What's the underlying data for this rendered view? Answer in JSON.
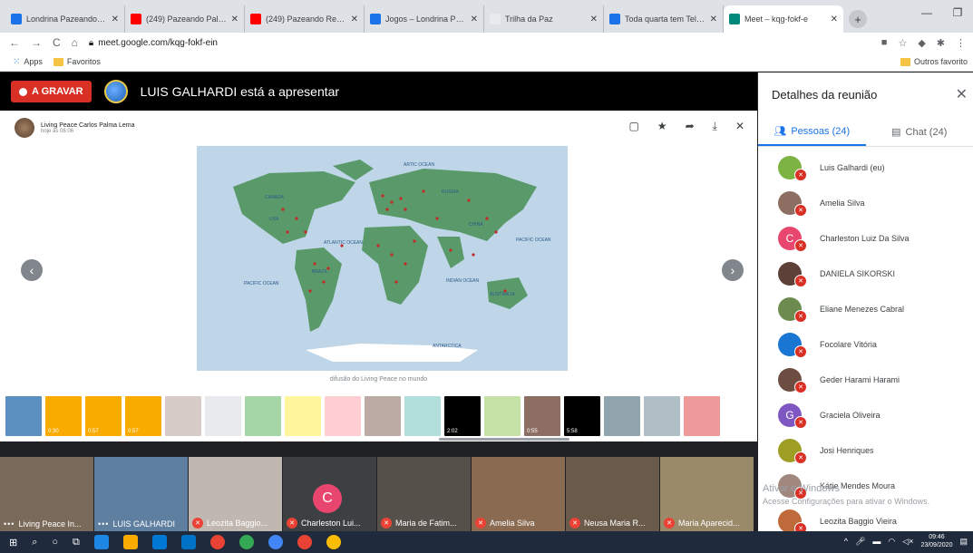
{
  "browser": {
    "tabs": [
      {
        "title": "Londrina Pazeando – E",
        "fav": "#1a73e8",
        "active": false
      },
      {
        "title": "(249) Pazeando Palestr",
        "fav": "#ff0000",
        "active": false
      },
      {
        "title": "(249) Pazeando Report",
        "fav": "#ff0000",
        "active": false
      },
      {
        "title": "Jogos – Londrina Pazea",
        "fav": "#1a73e8",
        "active": false
      },
      {
        "title": "Trilha da Paz",
        "fav": "#e8eaed",
        "active": false
      },
      {
        "title": "Toda quarta tem Telecc",
        "fav": "#1a73e8",
        "active": false
      },
      {
        "title": "Meet – kqg-fokf-e",
        "fav": "#00897b",
        "active": true
      }
    ],
    "url": "meet.google.com/kqg-fokf-ein",
    "bookmarks": {
      "apps": "Apps",
      "favoritos": "Favoritos",
      "outros": "Outros favorito"
    }
  },
  "meeting": {
    "recording": "A GRAVAR",
    "presenter_text": "LUIS GALHARDI está a apresentar"
  },
  "slide": {
    "author": "Living Peace Carlos Palma Lema",
    "time": "hoje às 06:06",
    "caption": "difusão do Living Peace no mundo",
    "map_labels": {
      "artic": "ARTIC OCEAN",
      "russia": "RUSSIA",
      "canada": "CANADA",
      "usa": "USA",
      "china": "CHINA",
      "atlantic": "ATLANTIC OCEAN",
      "pacific_right": "PACIFIC OCEAN",
      "pacific_left": "PACIFIC OCEAN",
      "brazil": "BRAZIL",
      "indian": "INDIAN OCEAN",
      "australia": "AUSTRALIA",
      "antarctica": "ANTARCTICA"
    },
    "thumbnails": [
      {
        "color": "#5b8fbf",
        "cap": ""
      },
      {
        "color": "#f9ab00",
        "cap": "0:30"
      },
      {
        "color": "#f9ab00",
        "cap": "0:57"
      },
      {
        "color": "#f9ab00",
        "cap": "0:57"
      },
      {
        "color": "#d7ccc8",
        "cap": ""
      },
      {
        "color": "#e8eaed",
        "cap": ""
      },
      {
        "color": "#a5d6a7",
        "cap": ""
      },
      {
        "color": "#fff59d",
        "cap": ""
      },
      {
        "color": "#ffcdd2",
        "cap": ""
      },
      {
        "color": "#bcaaa4",
        "cap": ""
      },
      {
        "color": "#b2dfdb",
        "cap": ""
      },
      {
        "color": "#000000",
        "cap": "2:02"
      },
      {
        "color": "#c5e1a5",
        "cap": ""
      },
      {
        "color": "#8d6e63",
        "cap": "0:55"
      },
      {
        "color": "#000000",
        "cap": "5:58"
      },
      {
        "color": "#90a4ae",
        "cap": ""
      },
      {
        "color": "#b0bec5",
        "cap": ""
      },
      {
        "color": "#ef9a9a",
        "cap": ""
      }
    ]
  },
  "video_tiles": [
    {
      "name": "Living Peace In...",
      "bg": "#7a6a5a",
      "muted": false
    },
    {
      "name": "LUIS GALHARDI",
      "bg": "#5f7fa0",
      "muted": false
    },
    {
      "name": "Leozita Baggio...",
      "bg": "#c0b8b0",
      "muted": true
    },
    {
      "name": "Charleston Lui...",
      "bg": "#3c4043",
      "muted": true,
      "initial": "C"
    },
    {
      "name": "Maria de Fatim...",
      "bg": "#55504a",
      "muted": true
    },
    {
      "name": "Amelia Silva",
      "bg": "#8a6a50",
      "muted": true
    },
    {
      "name": "Neusa Maria R...",
      "bg": "#6a5a4a",
      "muted": true
    },
    {
      "name": "Maria Aparecid...",
      "bg": "#9a8a6a",
      "muted": true
    }
  ],
  "panel": {
    "title": "Detalhes da reunião",
    "people_tab": "Pessoas (24)",
    "chat_tab": "Chat (24)",
    "people": [
      {
        "name": "Luis Galhardi (eu)",
        "color": "#7cb342"
      },
      {
        "name": "Amelia Silva",
        "color": "#8d6e63"
      },
      {
        "name": "Charleston Luiz Da Silva",
        "color": "#e8466f",
        "initial": "C"
      },
      {
        "name": "DANIELA SIKORSKI",
        "color": "#5d4037"
      },
      {
        "name": "Eliane Menezes Cabral",
        "color": "#6d8b4f"
      },
      {
        "name": "Focolare Vitória",
        "color": "#1976d2"
      },
      {
        "name": "Geder Harami Harami",
        "color": "#6d4c41"
      },
      {
        "name": "Graciela Oliveira",
        "color": "#7e57c2",
        "initial": "G"
      },
      {
        "name": "Josi Henriques",
        "color": "#9e9d24"
      },
      {
        "name": "Kátie Mendes Moura",
        "color": "#a1887f"
      },
      {
        "name": "Leozita Baggio Vieira",
        "color": "#bf6a3a"
      }
    ]
  },
  "watermark": {
    "line1": "Ativar o Windows",
    "line2": "Acesse Configurações para ativar o Windows."
  },
  "taskbar": {
    "time": "09:46",
    "date": "23/09/2020"
  }
}
